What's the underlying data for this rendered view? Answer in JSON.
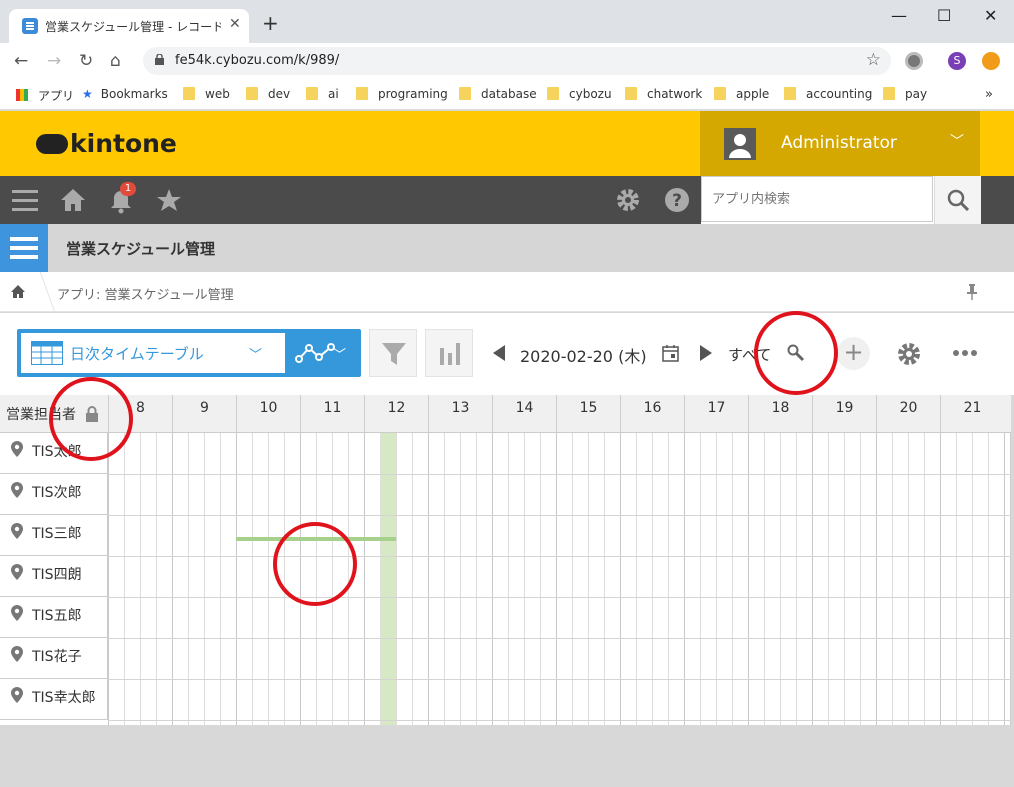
{
  "browser": {
    "tab_title": "営業スケジュール管理 - レコードの一覧",
    "url": "fe54k.cybozu.com/k/989/",
    "profile_initial": "S",
    "bookmarks": [
      "アプリ",
      "Bookmarks",
      "web",
      "dev",
      "ai",
      "programing",
      "database",
      "cybozu",
      "chatwork",
      "apple",
      "accounting",
      "pay"
    ]
  },
  "header": {
    "logo_text": "kintone",
    "user_name": "Administrator",
    "notification_count": "1",
    "search_placeholder": "アプリ内検索",
    "brand_color": "#ffc800"
  },
  "app": {
    "title": "営業スケジュール管理",
    "breadcrumb": "アプリ: 営業スケジュール管理"
  },
  "toolbar": {
    "view_name": "日次タイムテーブル",
    "date": "2020-02-20 (木)",
    "filter_scope": "すべて"
  },
  "timetable": {
    "label_header": "営業担当者",
    "hours": [
      "8",
      "9",
      "10",
      "11",
      "12",
      "13",
      "14",
      "15",
      "16",
      "17",
      "18",
      "19",
      "20",
      "21"
    ],
    "people": [
      "TIS太郎",
      "TIS次郎",
      "TIS三郎",
      "TIS四朗",
      "TIS五郎",
      "TIS花子",
      "TIS幸太郎"
    ],
    "highlight_color": "#d6e8c4",
    "event_line_color": "#a8d08d"
  }
}
